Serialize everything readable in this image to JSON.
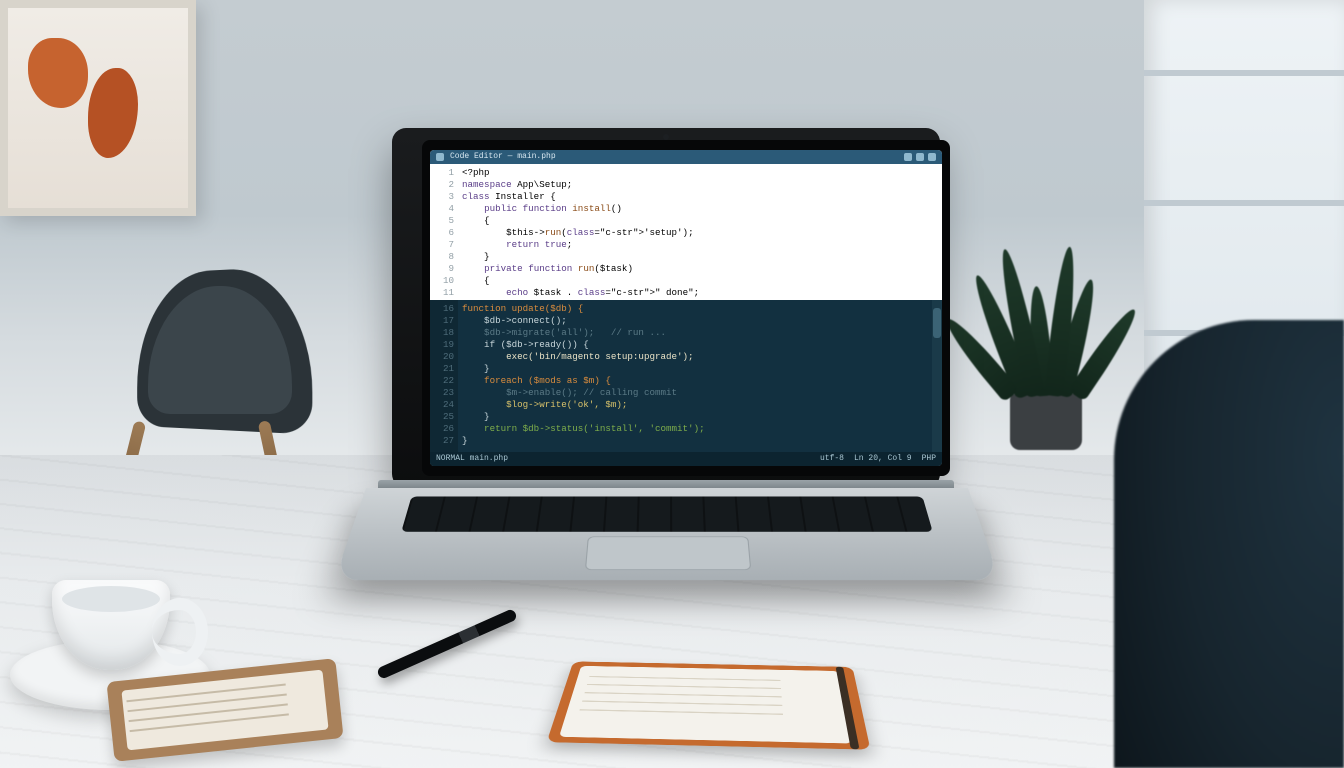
{
  "scene": {
    "description": "Photo-style workspace: laptop on light wooden desk with code editor on screen, coffee cup, notebooks and pen, chair and plant in background, window at right, person's shoulder in foreground."
  },
  "editor": {
    "titlebar": {
      "text": "Code Editor — main.php"
    },
    "top_pane": {
      "line_start": 1,
      "lines": [
        "<?php",
        "namespace App\\Setup;",
        "",
        "class Installer {",
        "    public function install()",
        "    {",
        "        $this->run('setup');",
        "        return true;",
        "    }",
        "",
        "    private function run($task)",
        "    {",
        "        echo $task . \" done\";",
        "    }",
        "}"
      ]
    },
    "bottom_pane": {
      "line_start": 16,
      "lines": [
        {
          "t": "function update($db) {",
          "cls": "d-kw"
        },
        {
          "t": "    $db->connect();",
          "cls": ""
        },
        {
          "t": "    $db->migrate('all');   // run ...",
          "cls": "d-cm"
        },
        {
          "t": "    if ($db->ready()) {",
          "cls": ""
        },
        {
          "t": "        exec('bin/magento setup:upgrade');",
          "cls": "d-hl"
        },
        {
          "t": "    }",
          "cls": ""
        },
        {
          "t": "    foreach ($mods as $m) {",
          "cls": "d-kw"
        },
        {
          "t": "        $m->enable(); // calling commit",
          "cls": "d-cm"
        },
        {
          "t": "        $log->write('ok', $m);",
          "cls": "d-str"
        },
        {
          "t": "    }",
          "cls": ""
        },
        {
          "t": "    return $db->status('install', 'commit');",
          "cls": "d-fn"
        },
        {
          "t": "}",
          "cls": ""
        }
      ]
    },
    "statusbar": {
      "left": "NORMAL  main.php",
      "right1": "utf-8",
      "right2": "Ln 20, Col 9",
      "right3": "PHP"
    }
  }
}
